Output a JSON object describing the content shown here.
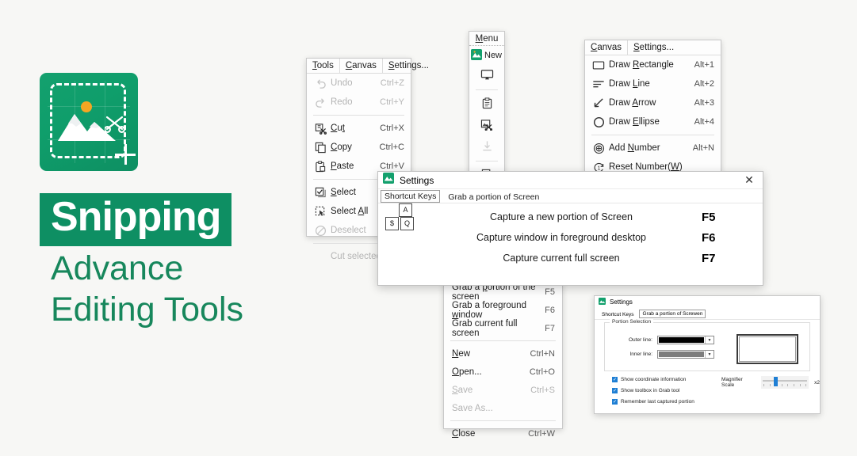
{
  "brand": {
    "logo_alt": "snipping-tool-logo",
    "title": "Snipping",
    "subtitle_line1": "Advance",
    "subtitle_line2": "Editing Tools",
    "brand_green": "#0e8f63",
    "accent_orange": "#f5a623"
  },
  "tools_menu": {
    "menubar": [
      {
        "label": "Tools",
        "underline": "T"
      },
      {
        "label": "Canvas",
        "underline": "C"
      },
      {
        "label": "Settings...",
        "underline": "S"
      }
    ],
    "items": [
      {
        "icon": "undo-icon",
        "label": "Undo",
        "accel": "Ctrl+Z",
        "disabled": true
      },
      {
        "icon": "redo-icon",
        "label": "Redo",
        "accel": "Ctrl+Y",
        "disabled": true
      },
      {
        "icon": "cut-icon",
        "label": "Cut",
        "accel": "Ctrl+X",
        "disabled": false
      },
      {
        "icon": "copy-icon",
        "label": "Copy",
        "accel": "Ctrl+C",
        "disabled": false
      },
      {
        "icon": "paste-icon",
        "label": "Paste",
        "accel": "Ctrl+V",
        "disabled": false
      },
      {
        "icon": "select-icon",
        "label": "Select",
        "accel": "",
        "disabled": false
      },
      {
        "icon": "select-all-icon",
        "label": "Select All",
        "accel": "",
        "disabled": false
      },
      {
        "icon": "deselect-icon",
        "label": "Deselect",
        "accel": "",
        "disabled": true
      },
      {
        "icon": "",
        "label": "Cut selected",
        "accel": "",
        "disabled": true
      }
    ]
  },
  "menu_toolbar": {
    "header": "Menu",
    "new_label": "New",
    "buttons": [
      {
        "icon": "new-snip-icon",
        "disabled": false
      },
      {
        "icon": "monitor-icon",
        "disabled": false
      },
      {
        "icon": "clipboard-icon",
        "disabled": false
      },
      {
        "icon": "image-cut-icon",
        "disabled": false
      },
      {
        "icon": "save-download-icon",
        "disabled": true
      },
      {
        "icon": "select-icon",
        "disabled": false
      },
      {
        "icon": "cut-icon",
        "disabled": false
      }
    ]
  },
  "canvas_menu": {
    "menubar": [
      {
        "label": "Canvas",
        "underline": "C"
      },
      {
        "label": "Settings...",
        "underline": "S"
      }
    ],
    "items": [
      {
        "icon": "rectangle-icon",
        "label": "Draw Rectangle",
        "accel": "Alt+1"
      },
      {
        "icon": "line-icon",
        "label": "Draw Line",
        "accel": "Alt+2"
      },
      {
        "icon": "arrow-icon",
        "label": "Draw Arrow",
        "accel": "Alt+3"
      },
      {
        "icon": "ellipse-icon",
        "label": "Draw Ellipse",
        "accel": "Alt+4"
      },
      {
        "icon": "add-number-icon",
        "label": "Add Number",
        "accel": "Alt+N"
      },
      {
        "icon": "reset-number-icon",
        "label": "Reset Number(W)",
        "accel": ""
      }
    ]
  },
  "settings_dialog": {
    "title": "Settings",
    "close_label": "✕",
    "tabs": [
      {
        "label": "Shortcut Keys",
        "active": true
      },
      {
        "label": "Grab a portion of Screen",
        "active": false
      }
    ],
    "keyboard_icon_keys": {
      "top": "A",
      "bottom_left": "$",
      "bottom_right": "Q"
    },
    "shortcuts": [
      {
        "description": "Capture a new portion of Screen",
        "key": "F5"
      },
      {
        "description": "Capture window in foreground desktop",
        "key": "F6"
      },
      {
        "description": "Capture current full screen",
        "key": "F7"
      }
    ]
  },
  "context_menu": {
    "items": [
      {
        "label": "Grab a portion of the screen",
        "accel": "F5",
        "disabled": false,
        "sep_after": false
      },
      {
        "label": "Grab a foreground window",
        "accel": "F6",
        "disabled": false,
        "sep_after": false
      },
      {
        "label": "Grab current full screen",
        "accel": "F7",
        "disabled": false,
        "sep_after": true
      },
      {
        "label": "New",
        "accel": "Ctrl+N",
        "disabled": false,
        "sep_after": false
      },
      {
        "label": "Open...",
        "accel": "Ctrl+O",
        "disabled": false,
        "sep_after": false
      },
      {
        "label": "Save",
        "accel": "Ctrl+S",
        "disabled": true,
        "sep_after": false
      },
      {
        "label": "Save As...",
        "accel": "",
        "disabled": true,
        "sep_after": true
      },
      {
        "label": "Close",
        "accel": "Ctrl+W",
        "disabled": false,
        "sep_after": false
      }
    ]
  },
  "mini_settings": {
    "title": "Settings",
    "tabs": [
      {
        "label": "Shortcut Keys",
        "active": false
      },
      {
        "label": "Grab a portion of Screwen",
        "active": true
      }
    ],
    "group_title": "Portion Selection",
    "outer_line_label": "Outer line:",
    "outer_line_color": "#000000",
    "inner_line_label": "Inner line:",
    "inner_line_color": "#7d7d7d",
    "checkboxes": [
      {
        "label": "Show coordinate information",
        "checked": true
      },
      {
        "label": "Show toolbox in Grab tool",
        "checked": true
      },
      {
        "label": "Remember last captured portion",
        "checked": true
      }
    ],
    "magnifier_label": "Magnifier Scale",
    "magnifier_value": "x2",
    "checkbox_color": "#1f7fd4"
  }
}
